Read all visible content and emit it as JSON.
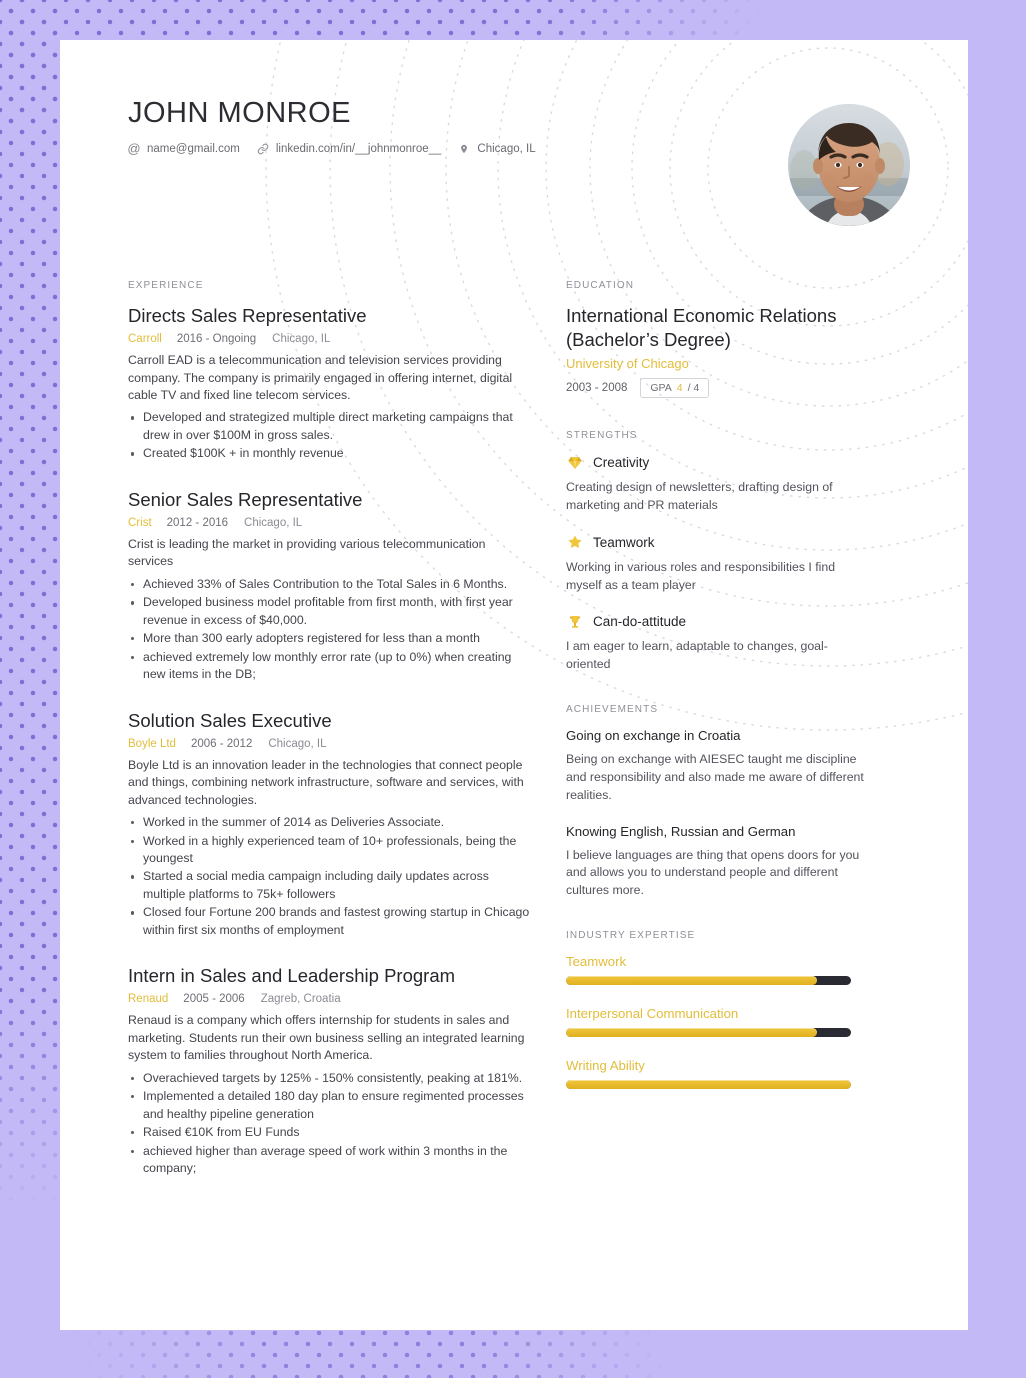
{
  "header": {
    "name": "JOHN MONROE",
    "contacts": [
      {
        "icon": "at-icon",
        "text": "name@gmail.com"
      },
      {
        "icon": "link-icon",
        "text": "linkedin.com/in/__johnmonroe__"
      },
      {
        "icon": "location-pin-icon",
        "text": "Chicago, IL"
      }
    ],
    "avatar_alt": "profile-photo"
  },
  "theme": {
    "accent": "#e2bd3a",
    "background": "#c3b9f7",
    "dot": "#7d6fd4",
    "page": "#ffffff",
    "text": "#25252b"
  },
  "experience": {
    "label": "EXPERIENCE",
    "jobs": [
      {
        "title": "Directs Sales Representative",
        "company": "Carroll",
        "dates": "2016 - Ongoing",
        "location": "Chicago, IL",
        "description": "Carroll EAD is a telecommunication and television services providing company. The company is primarily engaged in offering internet, digital cable TV and fixed line telecom services.",
        "bullets": [
          "Developed and strategized multiple direct marketing campaigns that drew in over $100M in gross sales.",
          "Created $100K + in monthly revenue"
        ]
      },
      {
        "title": "Senior Sales Representative",
        "company": "Crist",
        "dates": "2012 - 2016",
        "location": "Chicago, IL",
        "description": "Crist is leading the market in providing various telecommunication services",
        "bullets": [
          "Achieved 33% of Sales Contribution to the Total Sales in 6 Months.",
          "Developed business model profitable from first month, with first year revenue in excess of $40,000.",
          "More than 300 early adopters registered for less than a month",
          "achieved extremely low monthly error rate (up to 0%) when creating new items in the DB;"
        ]
      },
      {
        "title": "Solution Sales Executive",
        "company": "Boyle Ltd",
        "dates": "2006 - 2012",
        "location": "Chicago, IL",
        "description": "Boyle Ltd is an innovation leader in the technologies that connect people and things, combining network infrastructure, software and services, with advanced technologies.",
        "bullets": [
          "Worked in the summer of 2014 as Deliveries Associate.",
          "Worked in a highly experienced team of 10+ professionals, being the youngest",
          "Started a social media campaign including daily updates across multiple platforms to 75k+ followers",
          "Closed four Fortune 200 brands and fastest growing startup in Chicago within first six months of employment"
        ]
      },
      {
        "title": "Intern in Sales and Leadership Program",
        "company": "Renaud",
        "dates": "2005 - 2006",
        "location": "Zagreb, Croatia",
        "description": "Renaud is a company which offers internship for students in sales and marketing. Students run their own business selling an integrated learning system to families throughout North America.",
        "bullets": [
          "Overachieved targets by 125% - 150% consistently, peaking at 181%.",
          "Implemented a detailed 180 day plan to ensure regimented processes and healthy pipeline generation",
          "Raised €10K from EU Funds",
          "achieved higher than average speed of work within 3 months in the company;"
        ]
      }
    ]
  },
  "education": {
    "label": "EDUCATION",
    "degree": "International Economic Relations (Bachelor’s Degree)",
    "school": "University of Chicago",
    "dates": "2003 - 2008",
    "gpa_label": "GPA",
    "gpa_value": "4",
    "gpa_max": "/ 4"
  },
  "strengths": {
    "label": "STRENGTHS",
    "items": [
      {
        "icon": "gem-icon",
        "name": "Creativity",
        "description": "Creating design of newsletters, drafting design of marketing and PR materials"
      },
      {
        "icon": "star-icon",
        "name": "Teamwork",
        "description": "Working in various roles and responsibilities I find myself as a team player"
      },
      {
        "icon": "trophy-icon",
        "name": "Can-do-attitude",
        "description": "I am eager to learn, adaptable to changes, goal-oriented"
      }
    ]
  },
  "achievements": {
    "label": "ACHIEVEMENTS",
    "items": [
      {
        "title": "Going on exchange in Croatia",
        "description": "Being on exchange with AIESEC taught me discipline and responsibility and also made me aware of different realities."
      },
      {
        "title": "Knowing English, Russian and German",
        "description": "I believe languages are thing that opens doors for you and allows you to understand people and different cultures more."
      }
    ]
  },
  "expertise": {
    "label": "INDUSTRY EXPERTISE",
    "items": [
      {
        "name": "Teamwork",
        "percent": 88
      },
      {
        "name": "Interpersonal Communication",
        "percent": 88
      },
      {
        "name": "Writing Ability",
        "percent": 100
      }
    ]
  }
}
